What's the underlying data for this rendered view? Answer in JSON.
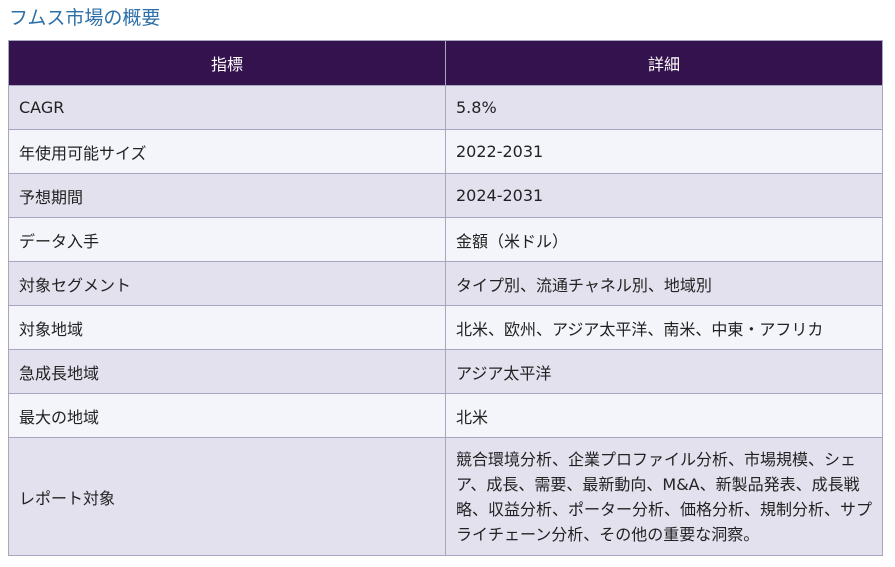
{
  "page": {
    "title": "フムス市場の概要"
  },
  "table": {
    "headers": [
      "指標",
      "詳細"
    ],
    "rows": [
      {
        "metric": "CAGR",
        "detail": "5.8%"
      },
      {
        "metric": "年使用可能サイズ",
        "detail": "2022-2031"
      },
      {
        "metric": "予想期間",
        "detail": "2024-2031"
      },
      {
        "metric": "データ入手",
        "detail": "金額（米ドル）"
      },
      {
        "metric": "対象セグメント",
        "detail": "タイプ別、流通チャネル別、地域別"
      },
      {
        "metric": "対象地域",
        "detail": "北米、欧州、アジア太平洋、南米、中東・アフリカ"
      },
      {
        "metric": "急成長地域",
        "detail": "アジア太平洋"
      },
      {
        "metric": "最大の地域",
        "detail": "北米"
      },
      {
        "metric": "レポート対象",
        "detail": "競合環境分析、企業プロファイル分析、市場規模、シェア、成長、需要、最新動向、M&A、新製品発表、成長戦略、収益分析、ポーター分析、価格分析、規制分析、サプライチェーン分析、その他の重要な洞察。"
      }
    ]
  },
  "colors": {
    "header_bg": "#34124e",
    "title": "#2d6fa8",
    "row_odd": "#e4e1ef",
    "row_even": "#f4f5fa"
  }
}
